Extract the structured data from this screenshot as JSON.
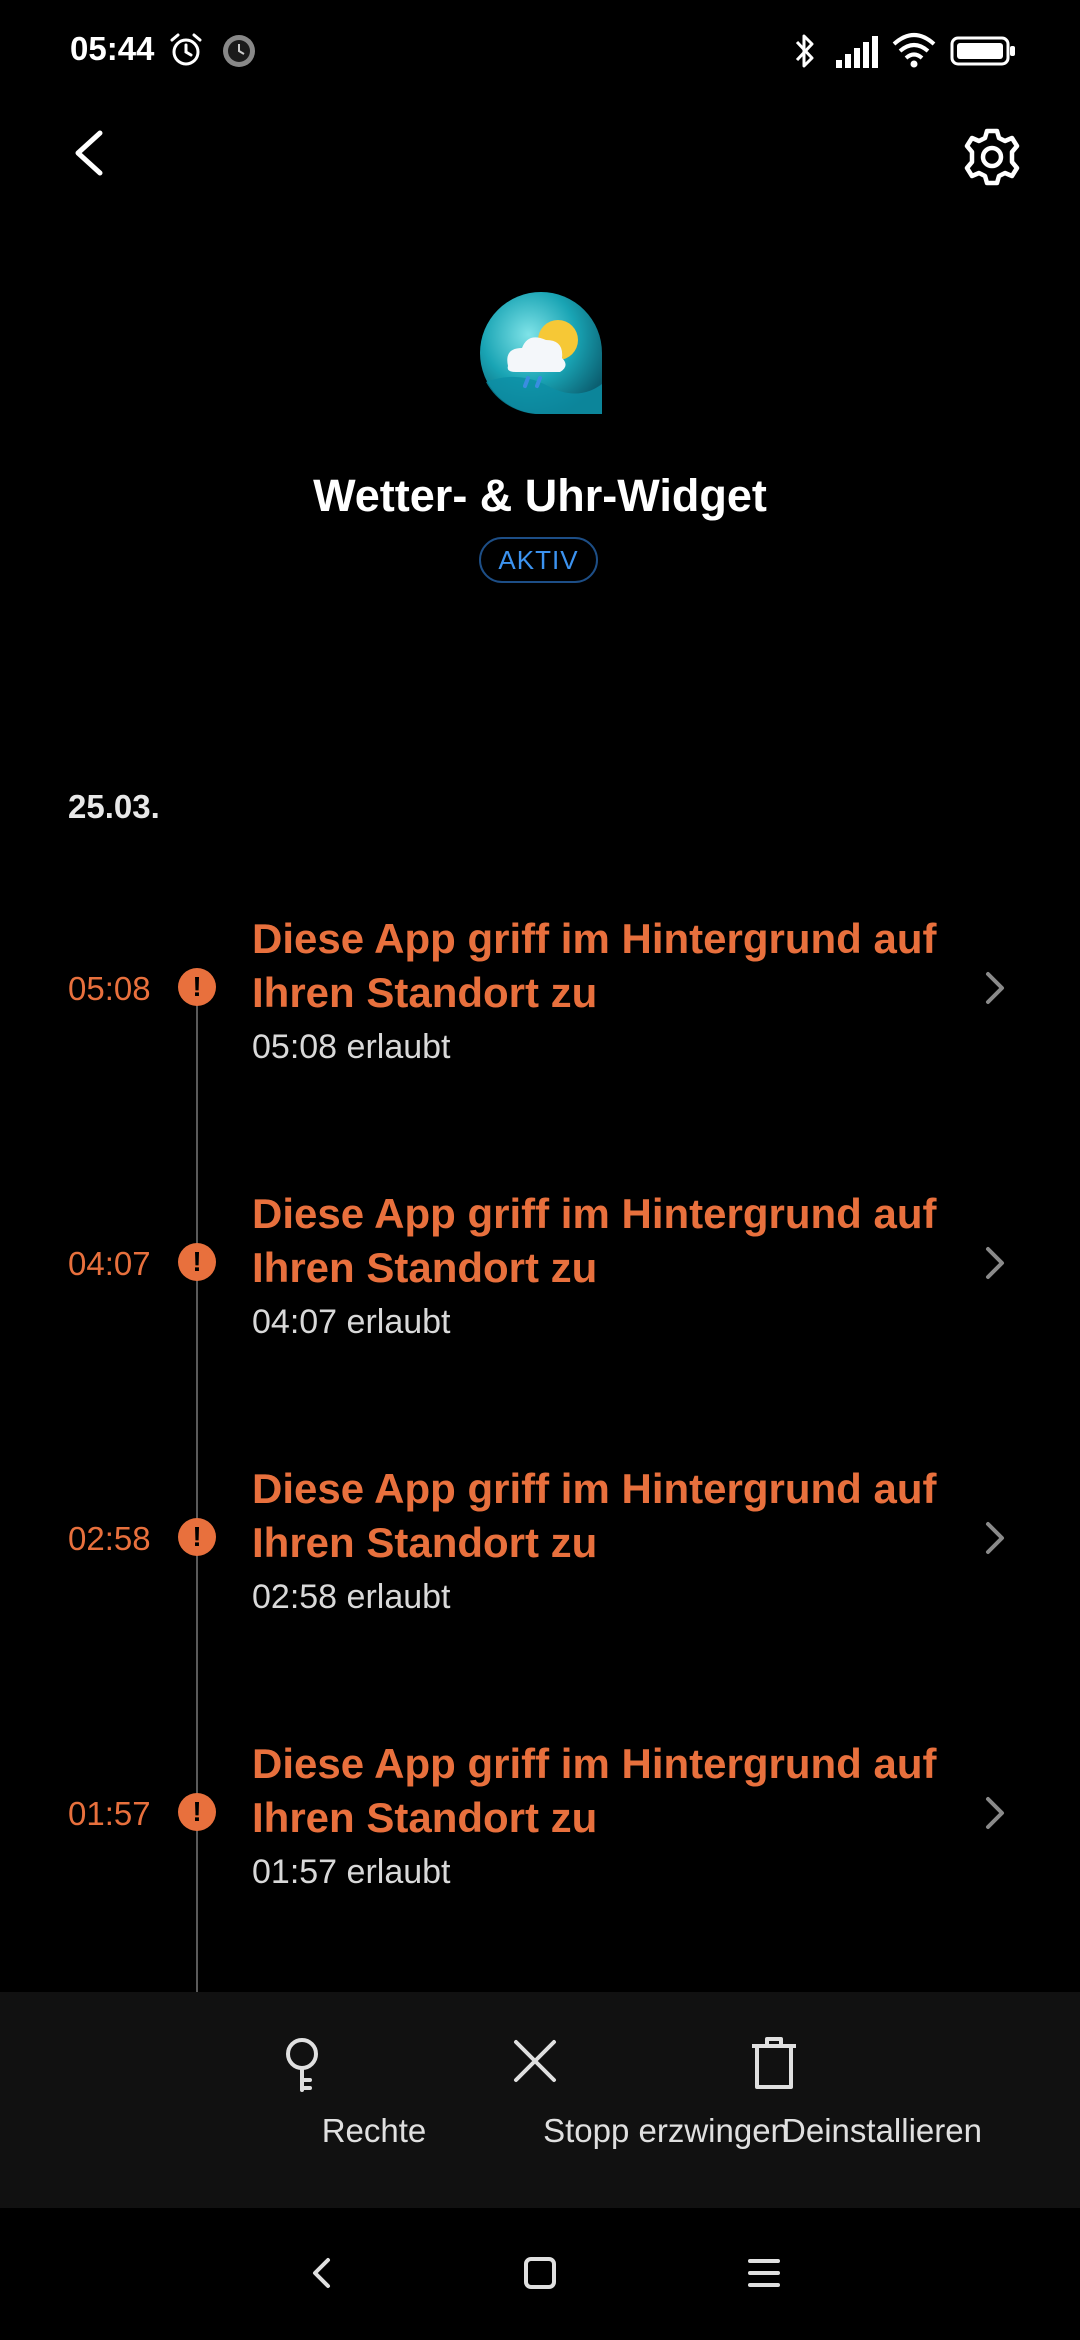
{
  "status_bar": {
    "time": "05:44",
    "icons": [
      "alarm-icon",
      "clock-icon",
      "bluetooth-icon",
      "signal-icon",
      "wifi-icon",
      "battery-icon"
    ]
  },
  "header": {
    "back_icon": "back-arrow-icon",
    "settings_icon": "gear-icon"
  },
  "app": {
    "name": "Wetter- & Uhr-Widget",
    "status": "AKTIV",
    "icon": "weather-app-icon"
  },
  "log": {
    "date": "25.03.",
    "events": [
      {
        "time": "05:08",
        "title": "Diese App griff im Hintergrund auf Ihren Standort zu",
        "detail": "05:08 erlaubt"
      },
      {
        "time": "04:07",
        "title": "Diese App griff im Hintergrund auf Ihren Standort zu",
        "detail": "04:07 erlaubt"
      },
      {
        "time": "02:58",
        "title": "Diese App griff im Hintergrund auf Ihren Standort zu",
        "detail": "02:58 erlaubt"
      },
      {
        "time": "01:57",
        "title": "Diese App griff im Hintergrund auf Ihren Standort zu",
        "detail": "01:57 erlaubt"
      }
    ]
  },
  "actions": {
    "permissions": "Rechte",
    "force_stop": "Stopp erzwingen",
    "uninstall": "Deinstallieren"
  },
  "colors": {
    "accent_orange": "#e8703d",
    "accent_blue": "#3c93f0",
    "background": "#000000",
    "action_bar": "#111111"
  }
}
